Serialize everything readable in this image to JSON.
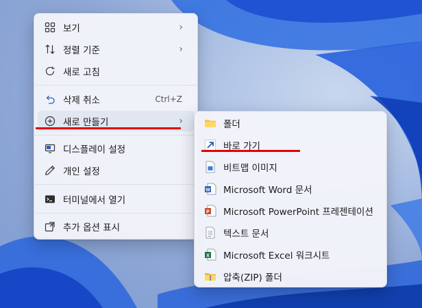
{
  "context_menu": {
    "items": [
      {
        "label": "보기",
        "icon": "view-grid-icon",
        "has_submenu": true
      },
      {
        "label": "정렬 기준",
        "icon": "sort-arrows-icon",
        "has_submenu": true
      },
      {
        "label": "새로 고침",
        "icon": "refresh-icon"
      },
      {
        "label": "삭제 취소",
        "icon": "undo-icon",
        "shortcut": "Ctrl+Z"
      },
      {
        "label": "새로 만들기",
        "icon": "new-plus-icon",
        "has_submenu": true
      },
      {
        "label": "디스플레이 설정",
        "icon": "display-icon"
      },
      {
        "label": "개인 설정",
        "icon": "pen-icon"
      },
      {
        "label": "터미널에서 열기",
        "icon": "terminal-icon"
      },
      {
        "label": "추가 옵션 표시",
        "icon": "more-options-icon"
      }
    ]
  },
  "new_submenu": {
    "items": [
      {
        "label": "폴더",
        "icon": "folder-icon"
      },
      {
        "label": "바로 가기",
        "icon": "shortcut-arrow-icon"
      },
      {
        "label": "비트맵 이미지",
        "icon": "bitmap-image-icon"
      },
      {
        "label": "Microsoft Word 문서",
        "icon": "word-doc-icon"
      },
      {
        "label": "Microsoft PowerPoint 프레젠테이션",
        "icon": "powerpoint-doc-icon"
      },
      {
        "label": "텍스트 문서",
        "icon": "text-doc-icon"
      },
      {
        "label": "Microsoft Excel 워크시트",
        "icon": "excel-doc-icon"
      },
      {
        "label": "압축(ZIP) 폴더",
        "icon": "zip-folder-icon"
      }
    ]
  },
  "colors": {
    "annotation_red": "#e00000",
    "word_blue": "#2b5fb4",
    "powerpoint_red": "#c94a2a",
    "excel_green": "#217346",
    "folder_yellow": "#f6c344"
  }
}
